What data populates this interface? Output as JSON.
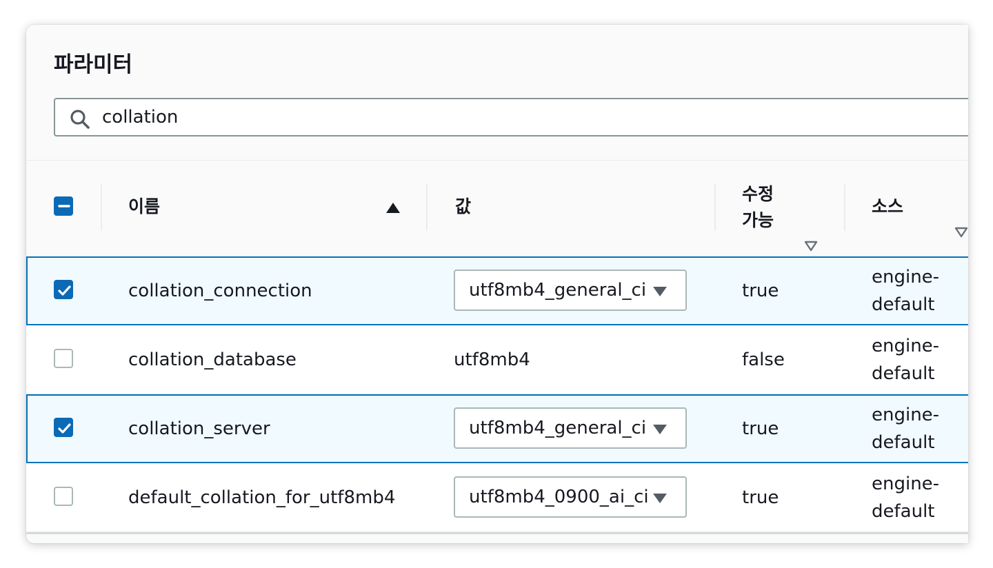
{
  "title": "파라미터",
  "search": {
    "value": "collation",
    "icon": "search-icon"
  },
  "columns": {
    "name": "이름",
    "value": "값",
    "modifiable_line1": "수정",
    "modifiable_line2": "가능",
    "source": "소스"
  },
  "sort": {
    "column": "name",
    "direction": "ascending"
  },
  "header_checkbox": "indeterminate",
  "rows": [
    {
      "selected": true,
      "name": "collation_connection",
      "value": "utf8mb4_general_ci",
      "editable": true,
      "modifiable": "true",
      "source_line1": "engine-",
      "source_line2": "default"
    },
    {
      "selected": false,
      "name": "collation_database",
      "value": "utf8mb4",
      "editable": false,
      "modifiable": "false",
      "source_line1": "engine-",
      "source_line2": "default"
    },
    {
      "selected": true,
      "name": "collation_server",
      "value": "utf8mb4_general_ci",
      "editable": true,
      "modifiable": "true",
      "source_line1": "engine-",
      "source_line2": "default"
    },
    {
      "selected": false,
      "name": "default_collation_for_utf8mb4",
      "value": "utf8mb4_0900_ai_ci",
      "editable": true,
      "modifiable": "true",
      "source_line1": "engine-",
      "source_line2": "default"
    }
  ],
  "colors": {
    "accent": "#0b6ab6",
    "selected_row_bg": "#f1faff",
    "selected_row_border": "#0073bb"
  }
}
